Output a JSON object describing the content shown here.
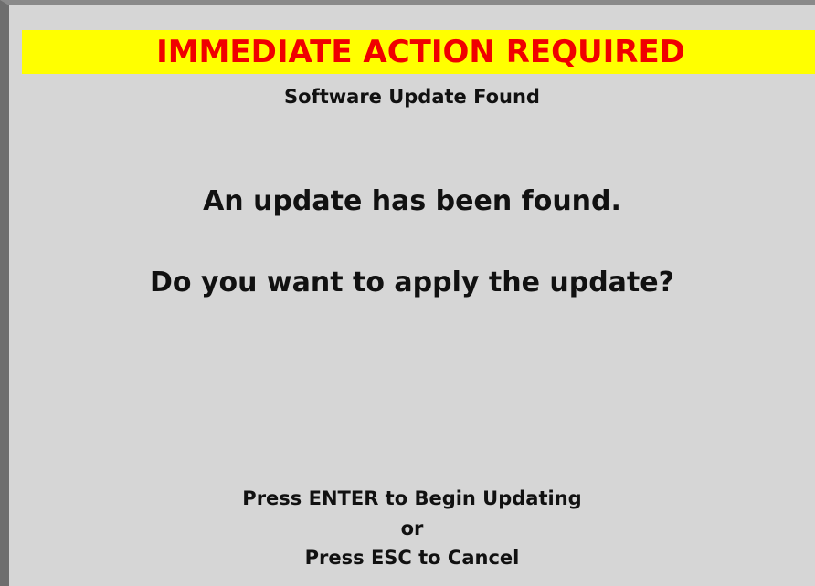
{
  "banner": {
    "text": "IMMEDIATE ACTION REQUIRED",
    "background": "#ffff00",
    "text_color": "#f00000"
  },
  "subtitle": "Software Update Found",
  "message": {
    "line1": "An update has been found.",
    "line2": "Do you want to apply the update?"
  },
  "instructions": {
    "enter": "Press ENTER to Begin Updating",
    "or": "or",
    "esc": "Press ESC to Cancel"
  },
  "colors": {
    "background": "#d6d6d6"
  }
}
